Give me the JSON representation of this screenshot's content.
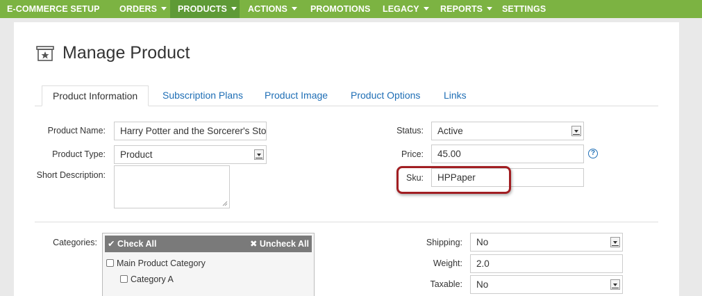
{
  "nav": {
    "items": [
      {
        "label": "E-COMMERCE SETUP"
      },
      {
        "label": "ORDERS"
      },
      {
        "label": "PRODUCTS"
      },
      {
        "label": "ACTIONS"
      },
      {
        "label": "PROMOTIONS"
      },
      {
        "label": "LEGACY"
      },
      {
        "label": "REPORTS"
      },
      {
        "label": "SETTINGS"
      }
    ]
  },
  "page": {
    "title": "Manage Product"
  },
  "tabs": [
    {
      "label": "Product Information"
    },
    {
      "label": "Subscription Plans"
    },
    {
      "label": "Product Image"
    },
    {
      "label": "Product Options"
    },
    {
      "label": "Links"
    }
  ],
  "form": {
    "product_name_label": "Product Name:",
    "product_name_value": "Harry Potter and the Sorcerer's Sto",
    "product_type_label": "Product Type:",
    "product_type_value": "Product",
    "short_description_label": "Short Description:",
    "status_label": "Status:",
    "status_value": "Active",
    "price_label": "Price:",
    "price_value": "45.00",
    "sku_label": "Sku:",
    "sku_value": "HPPaper",
    "help_glyph": "?",
    "categories_label": "Categories:",
    "check_all": "✔ Check All",
    "uncheck_all": "✖ Uncheck All",
    "category_items": [
      "Main Product Category",
      "Category A"
    ],
    "shipping_label": "Shipping:",
    "shipping_value": "No",
    "weight_label": "Weight:",
    "weight_value": "2.0",
    "taxable_label": "Taxable:",
    "taxable_value": "No"
  },
  "colors": {
    "nav_bg": "#7cb342",
    "nav_active": "#5e9a36",
    "link": "#1e6eb5",
    "highlight": "#a11e22"
  }
}
